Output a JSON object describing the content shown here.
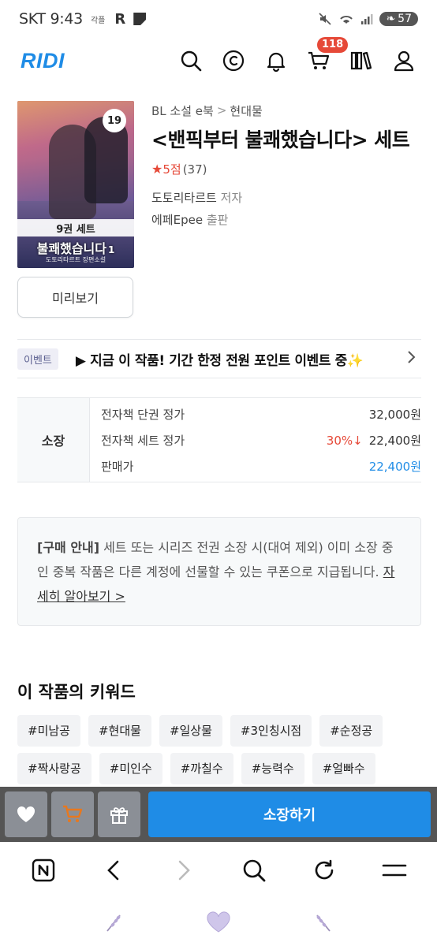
{
  "status_bar": {
    "time": "SKT 9:43",
    "carrier_extra": "각플",
    "r_icon_label": "R",
    "battery": "57"
  },
  "header": {
    "logo": "RIDI",
    "cart_badge": "118",
    "icons": [
      "search-icon",
      "coin-icon",
      "bell-icon",
      "cart-icon",
      "library-icon",
      "user-icon"
    ]
  },
  "book": {
    "cover": {
      "volume_badge": "19",
      "band_text": "9권 세트",
      "cover_title": "불쾌했습니다",
      "cover_vol": "1",
      "cover_author": "도토리타르트 장편소설"
    },
    "breadcrumb": {
      "category": "BL 소설 e북",
      "separator": ">",
      "subcategory": "현대물"
    },
    "title": "<밴픽부터 불쾌했습니다> 세트",
    "rating": {
      "star": "★",
      "score": "5점",
      "count": "(37)"
    },
    "author": "도토리타르트",
    "author_role": "저자",
    "publisher": "에페Epee",
    "publisher_role": "출판",
    "preview_label": "미리보기"
  },
  "event": {
    "tag": "이벤트",
    "text": "▶ 지금 이 작품! 기간 한정 전원 포인트 이벤트 중✨",
    "chevron": "›"
  },
  "price": {
    "type_label": "소장",
    "rows": [
      {
        "label": "전자책 단권 정가",
        "discount": "",
        "value": "32,000원"
      },
      {
        "label": "전자책 세트 정가",
        "discount": "30%↓",
        "value": "22,400원"
      },
      {
        "label": "판매가",
        "discount": "",
        "value": "22,400원"
      }
    ]
  },
  "notice": {
    "heading": "[구매 안내]",
    "body": " 세트 또는 시리즈 전권 소장 시(대여 제외) 이미 소장 중인 중복 작품은 다른 계정에 선물할 수 있는 쿠폰으로 지급됩니다. ",
    "link": "자세히 알아보기 >"
  },
  "keywords": {
    "title": "이 작품의 키워드",
    "items": [
      "#미남공",
      "#현대물",
      "#일상물",
      "#3인칭시점",
      "#순정공",
      "#짝사랑공",
      "#미인수",
      "#까칠수",
      "#능력수",
      "#얼빠수"
    ]
  },
  "buy_bar": {
    "buy_label": "소장하기",
    "icons": [
      "heart-icon",
      "cart-icon",
      "gift-icon"
    ]
  },
  "browser_nav": {
    "icons": [
      "naver-home-icon",
      "back-icon",
      "forward-icon",
      "search-icon",
      "refresh-icon",
      "menu-icon"
    ]
  },
  "android_nav": {
    "icons": [
      "lavender-left-icon",
      "heart-home-icon",
      "lavender-right-icon"
    ]
  },
  "colors": {
    "brand_blue": "#1f8ce6",
    "discount_red": "#e64938",
    "badge_red": "#e64938"
  }
}
